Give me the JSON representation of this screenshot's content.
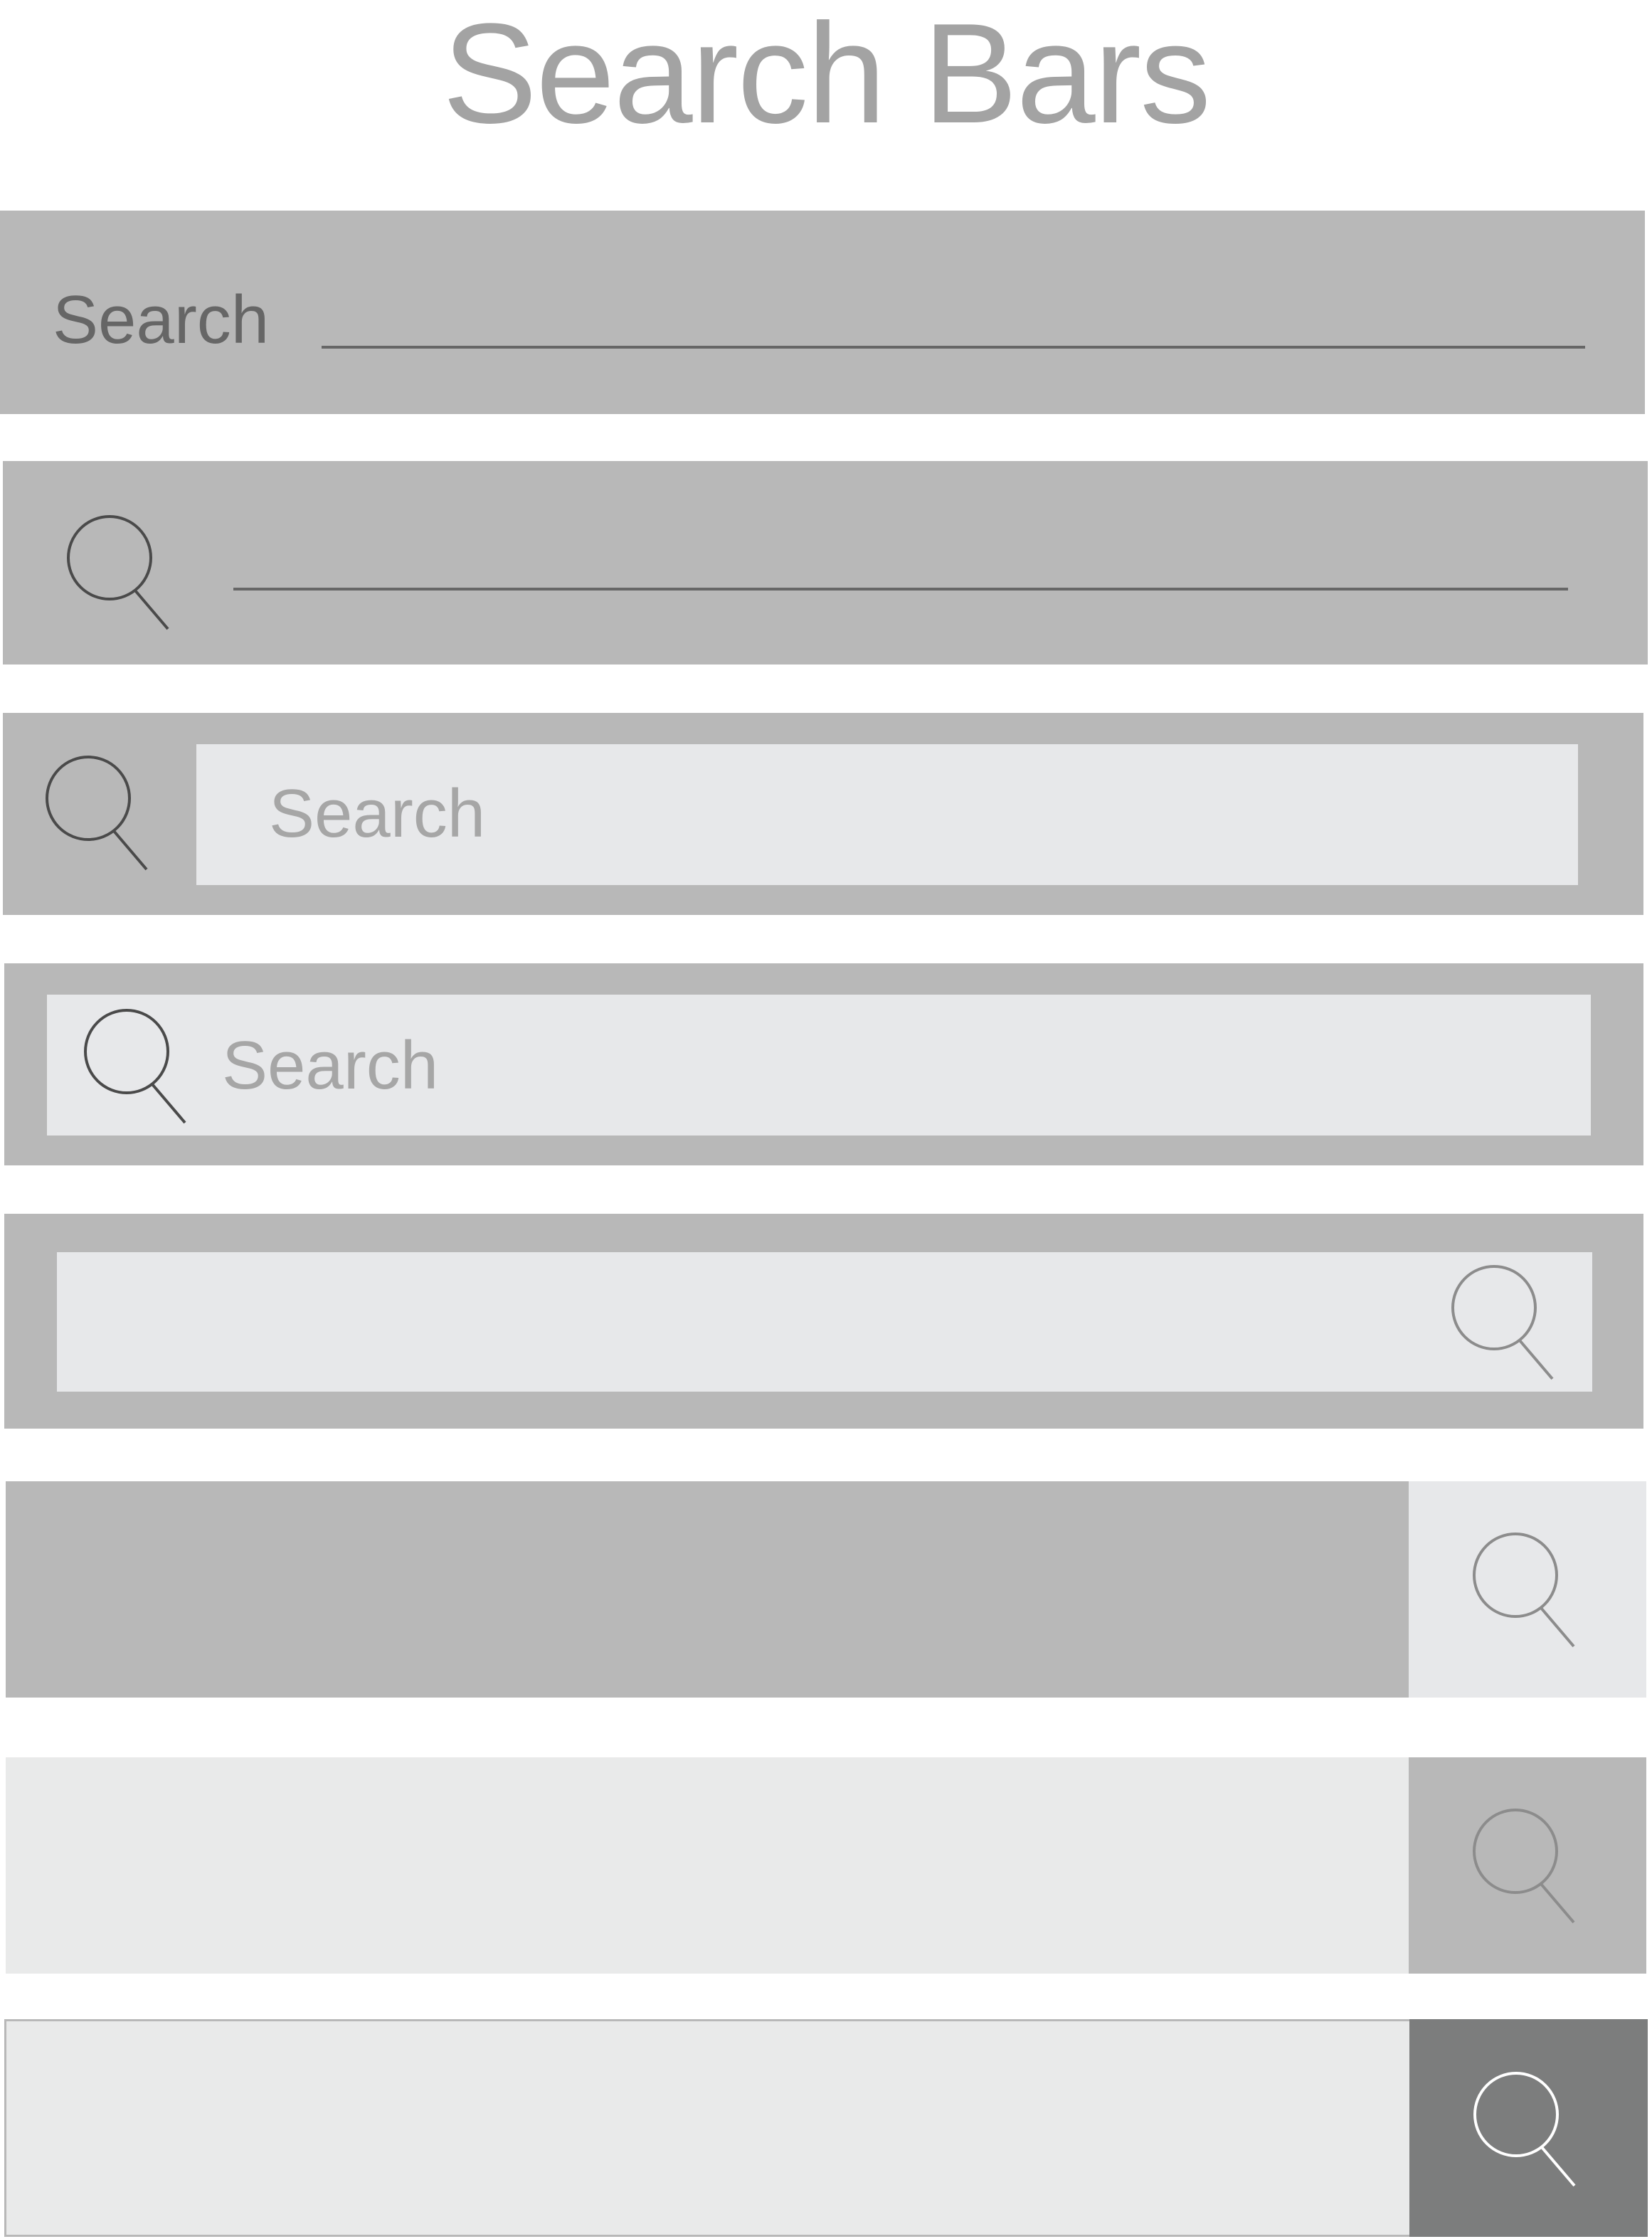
{
  "page": {
    "title": "Search Bars"
  },
  "bars": [
    {
      "style": "label-underline",
      "label": "Search"
    },
    {
      "style": "icon-underline",
      "icon": "search-icon"
    },
    {
      "style": "icon-outside-field",
      "icon": "search-icon",
      "placeholder": "Search"
    },
    {
      "style": "icon-inside-field",
      "icon": "search-icon",
      "placeholder": "Search"
    },
    {
      "style": "icon-right-inside-field",
      "icon": "search-icon"
    },
    {
      "style": "dark-field-light-button",
      "icon": "search-icon"
    },
    {
      "style": "light-field-mid-button",
      "icon": "search-icon"
    },
    {
      "style": "light-field-dark-button",
      "icon": "search-icon"
    }
  ],
  "colors": {
    "bar_gray": "#b8b8b8",
    "field_light": "#e7e8ea",
    "field_lighter": "#e9eaea",
    "button_dark": "#7c7d7d",
    "title_text": "#a3a3a3",
    "label_text": "#666666",
    "placeholder_text": "#a6a6a6",
    "icon_dark": "#4a4a4a",
    "icon_mid": "#8c8c8c",
    "icon_white": "#ffffff"
  }
}
